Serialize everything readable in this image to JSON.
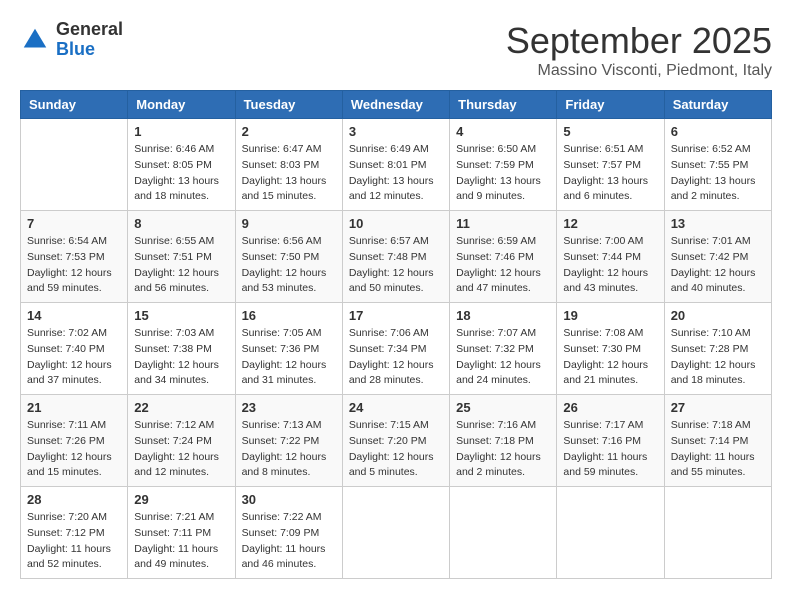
{
  "header": {
    "logo": {
      "general": "General",
      "blue": "Blue"
    },
    "title": "September 2025",
    "location": "Massino Visconti, Piedmont, Italy"
  },
  "calendar": {
    "days_of_week": [
      "Sunday",
      "Monday",
      "Tuesday",
      "Wednesday",
      "Thursday",
      "Friday",
      "Saturday"
    ],
    "weeks": [
      [
        {
          "day": "",
          "info": ""
        },
        {
          "day": "1",
          "info": "Sunrise: 6:46 AM\nSunset: 8:05 PM\nDaylight: 13 hours\nand 18 minutes."
        },
        {
          "day": "2",
          "info": "Sunrise: 6:47 AM\nSunset: 8:03 PM\nDaylight: 13 hours\nand 15 minutes."
        },
        {
          "day": "3",
          "info": "Sunrise: 6:49 AM\nSunset: 8:01 PM\nDaylight: 13 hours\nand 12 minutes."
        },
        {
          "day": "4",
          "info": "Sunrise: 6:50 AM\nSunset: 7:59 PM\nDaylight: 13 hours\nand 9 minutes."
        },
        {
          "day": "5",
          "info": "Sunrise: 6:51 AM\nSunset: 7:57 PM\nDaylight: 13 hours\nand 6 minutes."
        },
        {
          "day": "6",
          "info": "Sunrise: 6:52 AM\nSunset: 7:55 PM\nDaylight: 13 hours\nand 2 minutes."
        }
      ],
      [
        {
          "day": "7",
          "info": "Sunrise: 6:54 AM\nSunset: 7:53 PM\nDaylight: 12 hours\nand 59 minutes."
        },
        {
          "day": "8",
          "info": "Sunrise: 6:55 AM\nSunset: 7:51 PM\nDaylight: 12 hours\nand 56 minutes."
        },
        {
          "day": "9",
          "info": "Sunrise: 6:56 AM\nSunset: 7:50 PM\nDaylight: 12 hours\nand 53 minutes."
        },
        {
          "day": "10",
          "info": "Sunrise: 6:57 AM\nSunset: 7:48 PM\nDaylight: 12 hours\nand 50 minutes."
        },
        {
          "day": "11",
          "info": "Sunrise: 6:59 AM\nSunset: 7:46 PM\nDaylight: 12 hours\nand 47 minutes."
        },
        {
          "day": "12",
          "info": "Sunrise: 7:00 AM\nSunset: 7:44 PM\nDaylight: 12 hours\nand 43 minutes."
        },
        {
          "day": "13",
          "info": "Sunrise: 7:01 AM\nSunset: 7:42 PM\nDaylight: 12 hours\nand 40 minutes."
        }
      ],
      [
        {
          "day": "14",
          "info": "Sunrise: 7:02 AM\nSunset: 7:40 PM\nDaylight: 12 hours\nand 37 minutes."
        },
        {
          "day": "15",
          "info": "Sunrise: 7:03 AM\nSunset: 7:38 PM\nDaylight: 12 hours\nand 34 minutes."
        },
        {
          "day": "16",
          "info": "Sunrise: 7:05 AM\nSunset: 7:36 PM\nDaylight: 12 hours\nand 31 minutes."
        },
        {
          "day": "17",
          "info": "Sunrise: 7:06 AM\nSunset: 7:34 PM\nDaylight: 12 hours\nand 28 minutes."
        },
        {
          "day": "18",
          "info": "Sunrise: 7:07 AM\nSunset: 7:32 PM\nDaylight: 12 hours\nand 24 minutes."
        },
        {
          "day": "19",
          "info": "Sunrise: 7:08 AM\nSunset: 7:30 PM\nDaylight: 12 hours\nand 21 minutes."
        },
        {
          "day": "20",
          "info": "Sunrise: 7:10 AM\nSunset: 7:28 PM\nDaylight: 12 hours\nand 18 minutes."
        }
      ],
      [
        {
          "day": "21",
          "info": "Sunrise: 7:11 AM\nSunset: 7:26 PM\nDaylight: 12 hours\nand 15 minutes."
        },
        {
          "day": "22",
          "info": "Sunrise: 7:12 AM\nSunset: 7:24 PM\nDaylight: 12 hours\nand 12 minutes."
        },
        {
          "day": "23",
          "info": "Sunrise: 7:13 AM\nSunset: 7:22 PM\nDaylight: 12 hours\nand 8 minutes."
        },
        {
          "day": "24",
          "info": "Sunrise: 7:15 AM\nSunset: 7:20 PM\nDaylight: 12 hours\nand 5 minutes."
        },
        {
          "day": "25",
          "info": "Sunrise: 7:16 AM\nSunset: 7:18 PM\nDaylight: 12 hours\nand 2 minutes."
        },
        {
          "day": "26",
          "info": "Sunrise: 7:17 AM\nSunset: 7:16 PM\nDaylight: 11 hours\nand 59 minutes."
        },
        {
          "day": "27",
          "info": "Sunrise: 7:18 AM\nSunset: 7:14 PM\nDaylight: 11 hours\nand 55 minutes."
        }
      ],
      [
        {
          "day": "28",
          "info": "Sunrise: 7:20 AM\nSunset: 7:12 PM\nDaylight: 11 hours\nand 52 minutes."
        },
        {
          "day": "29",
          "info": "Sunrise: 7:21 AM\nSunset: 7:11 PM\nDaylight: 11 hours\nand 49 minutes."
        },
        {
          "day": "30",
          "info": "Sunrise: 7:22 AM\nSunset: 7:09 PM\nDaylight: 11 hours\nand 46 minutes."
        },
        {
          "day": "",
          "info": ""
        },
        {
          "day": "",
          "info": ""
        },
        {
          "day": "",
          "info": ""
        },
        {
          "day": "",
          "info": ""
        }
      ]
    ]
  }
}
